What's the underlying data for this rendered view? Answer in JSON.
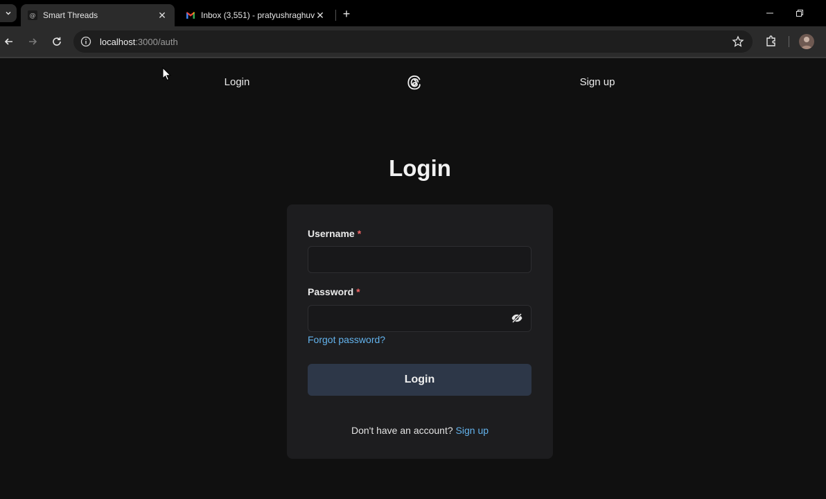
{
  "browser": {
    "tabs": [
      {
        "title": "Smart Threads",
        "active": true,
        "favicon": "threads-favicon"
      },
      {
        "title": "Inbox (3,551) - pratyushraghuv",
        "active": false,
        "favicon": "gmail-icon"
      }
    ],
    "url": {
      "host": "localhost",
      "path": ":3000/auth"
    }
  },
  "nav": {
    "login_label": "Login",
    "signup_label": "Sign up",
    "logo_icon": "threads-logo-icon"
  },
  "form": {
    "heading": "Login",
    "username_label": "Username",
    "password_label": "Password",
    "required_mark": "*",
    "username_value": "",
    "password_value": "",
    "forgot_label": "Forgot password?",
    "submit_label": "Login",
    "footer_text": "Don't have an account?",
    "footer_link": "Sign up"
  },
  "colors": {
    "background": "#101010",
    "card": "#1d1d1f",
    "link": "#63b3ed",
    "button": "#2d3748",
    "required": "#f56565"
  }
}
